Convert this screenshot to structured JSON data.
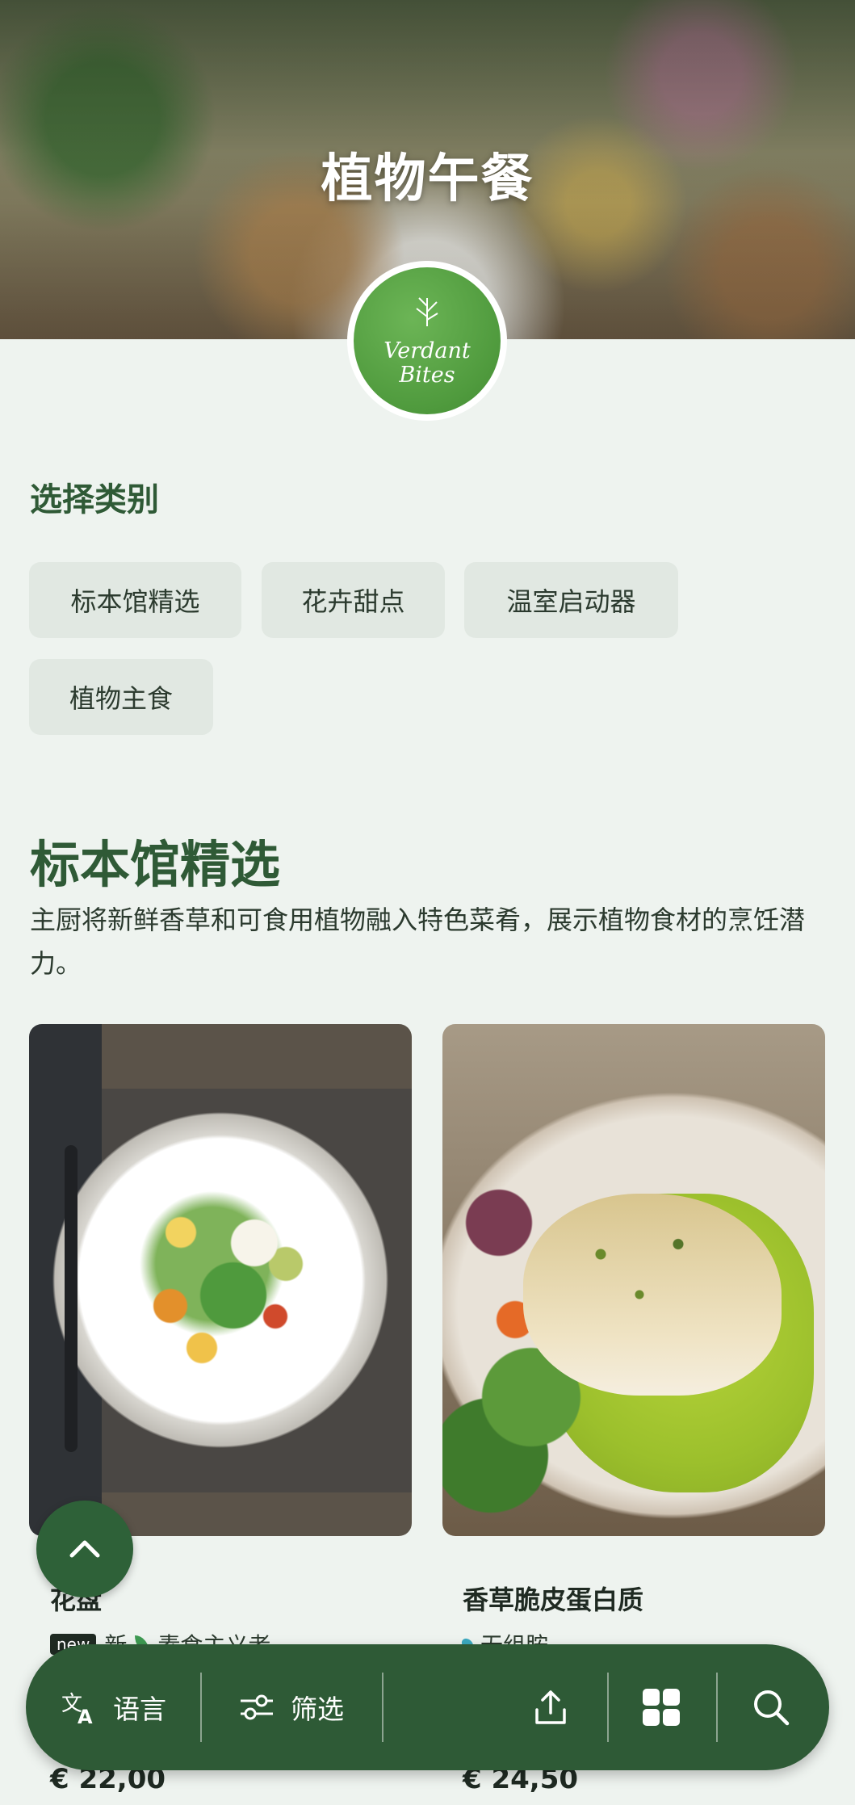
{
  "hero": {
    "title": "植物午餐"
  },
  "logo": {
    "line1": "Verdant",
    "line2": "Bites"
  },
  "categories": {
    "label": "选择类别",
    "chips": [
      "标本馆精选",
      "花卉甜点",
      "温室启动器",
      "植物主食"
    ]
  },
  "featured": {
    "title": "标本馆精选",
    "description": "主厨将新鲜香草和可食用植物融入特色菜肴，展示植物食材的烹饪潜力。"
  },
  "dishes": [
    {
      "name": "花盘",
      "badge": "new",
      "tag1": "新",
      "tag2": "素食主义者",
      "price": "€ 22,00"
    },
    {
      "name": "香草脆皮蛋白质",
      "tag1": "无组胺",
      "price": "€ 24,50"
    }
  ],
  "bottom_bar": {
    "language_label": "语言",
    "filter_label": "筛选",
    "icons": [
      "translate-icon",
      "filter-icon",
      "share-icon",
      "grid-icon",
      "search-icon"
    ]
  },
  "colors": {
    "primary": "#2e5a36",
    "accent": "#4f9a3d",
    "background": "#eef3ef"
  }
}
